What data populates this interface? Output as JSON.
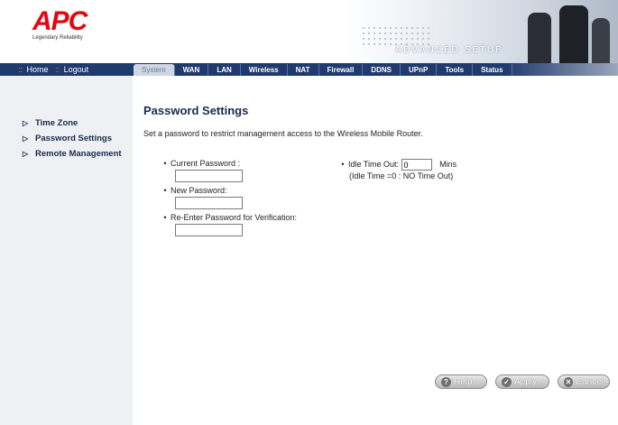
{
  "header": {
    "logo_text": "APC",
    "logo_tagline": "Legendary Reliability",
    "banner_title": "ADVANCED SETUP"
  },
  "nav": {
    "home_label": "Home",
    "logout_label": "Logout",
    "separator": "::",
    "tabs": [
      {
        "label": "System",
        "active": true
      },
      {
        "label": "WAN"
      },
      {
        "label": "LAN"
      },
      {
        "label": "Wireless"
      },
      {
        "label": "NAT"
      },
      {
        "label": "Firewall"
      },
      {
        "label": "DDNS"
      },
      {
        "label": "UPnP"
      },
      {
        "label": "Tools"
      },
      {
        "label": "Status"
      }
    ]
  },
  "sidebar": {
    "items": [
      {
        "label": "Time Zone"
      },
      {
        "label": "Password Settings"
      },
      {
        "label": "Remote Management"
      }
    ]
  },
  "main": {
    "title": "Password Settings",
    "description": "Set a password to restrict management access to the Wireless Mobile Router.",
    "fields": {
      "current_label": "Current Password :",
      "current_value": "",
      "new_label": "New Password:",
      "new_value": "",
      "reenter_label": "Re-Enter Password for Verification:",
      "reenter_value": ""
    },
    "idle": {
      "label": "Idle Time Out:",
      "value": "0",
      "unit": "Mins",
      "note": "(Idle Time =0 : NO Time Out)"
    },
    "buttons": {
      "help": "Help",
      "apply": "Apply",
      "cancel": "Cancel"
    }
  },
  "colors": {
    "brand_red": "#e30613",
    "nav_blue": "#1f3a6e",
    "sidebar_bg": "#eef0f4"
  }
}
